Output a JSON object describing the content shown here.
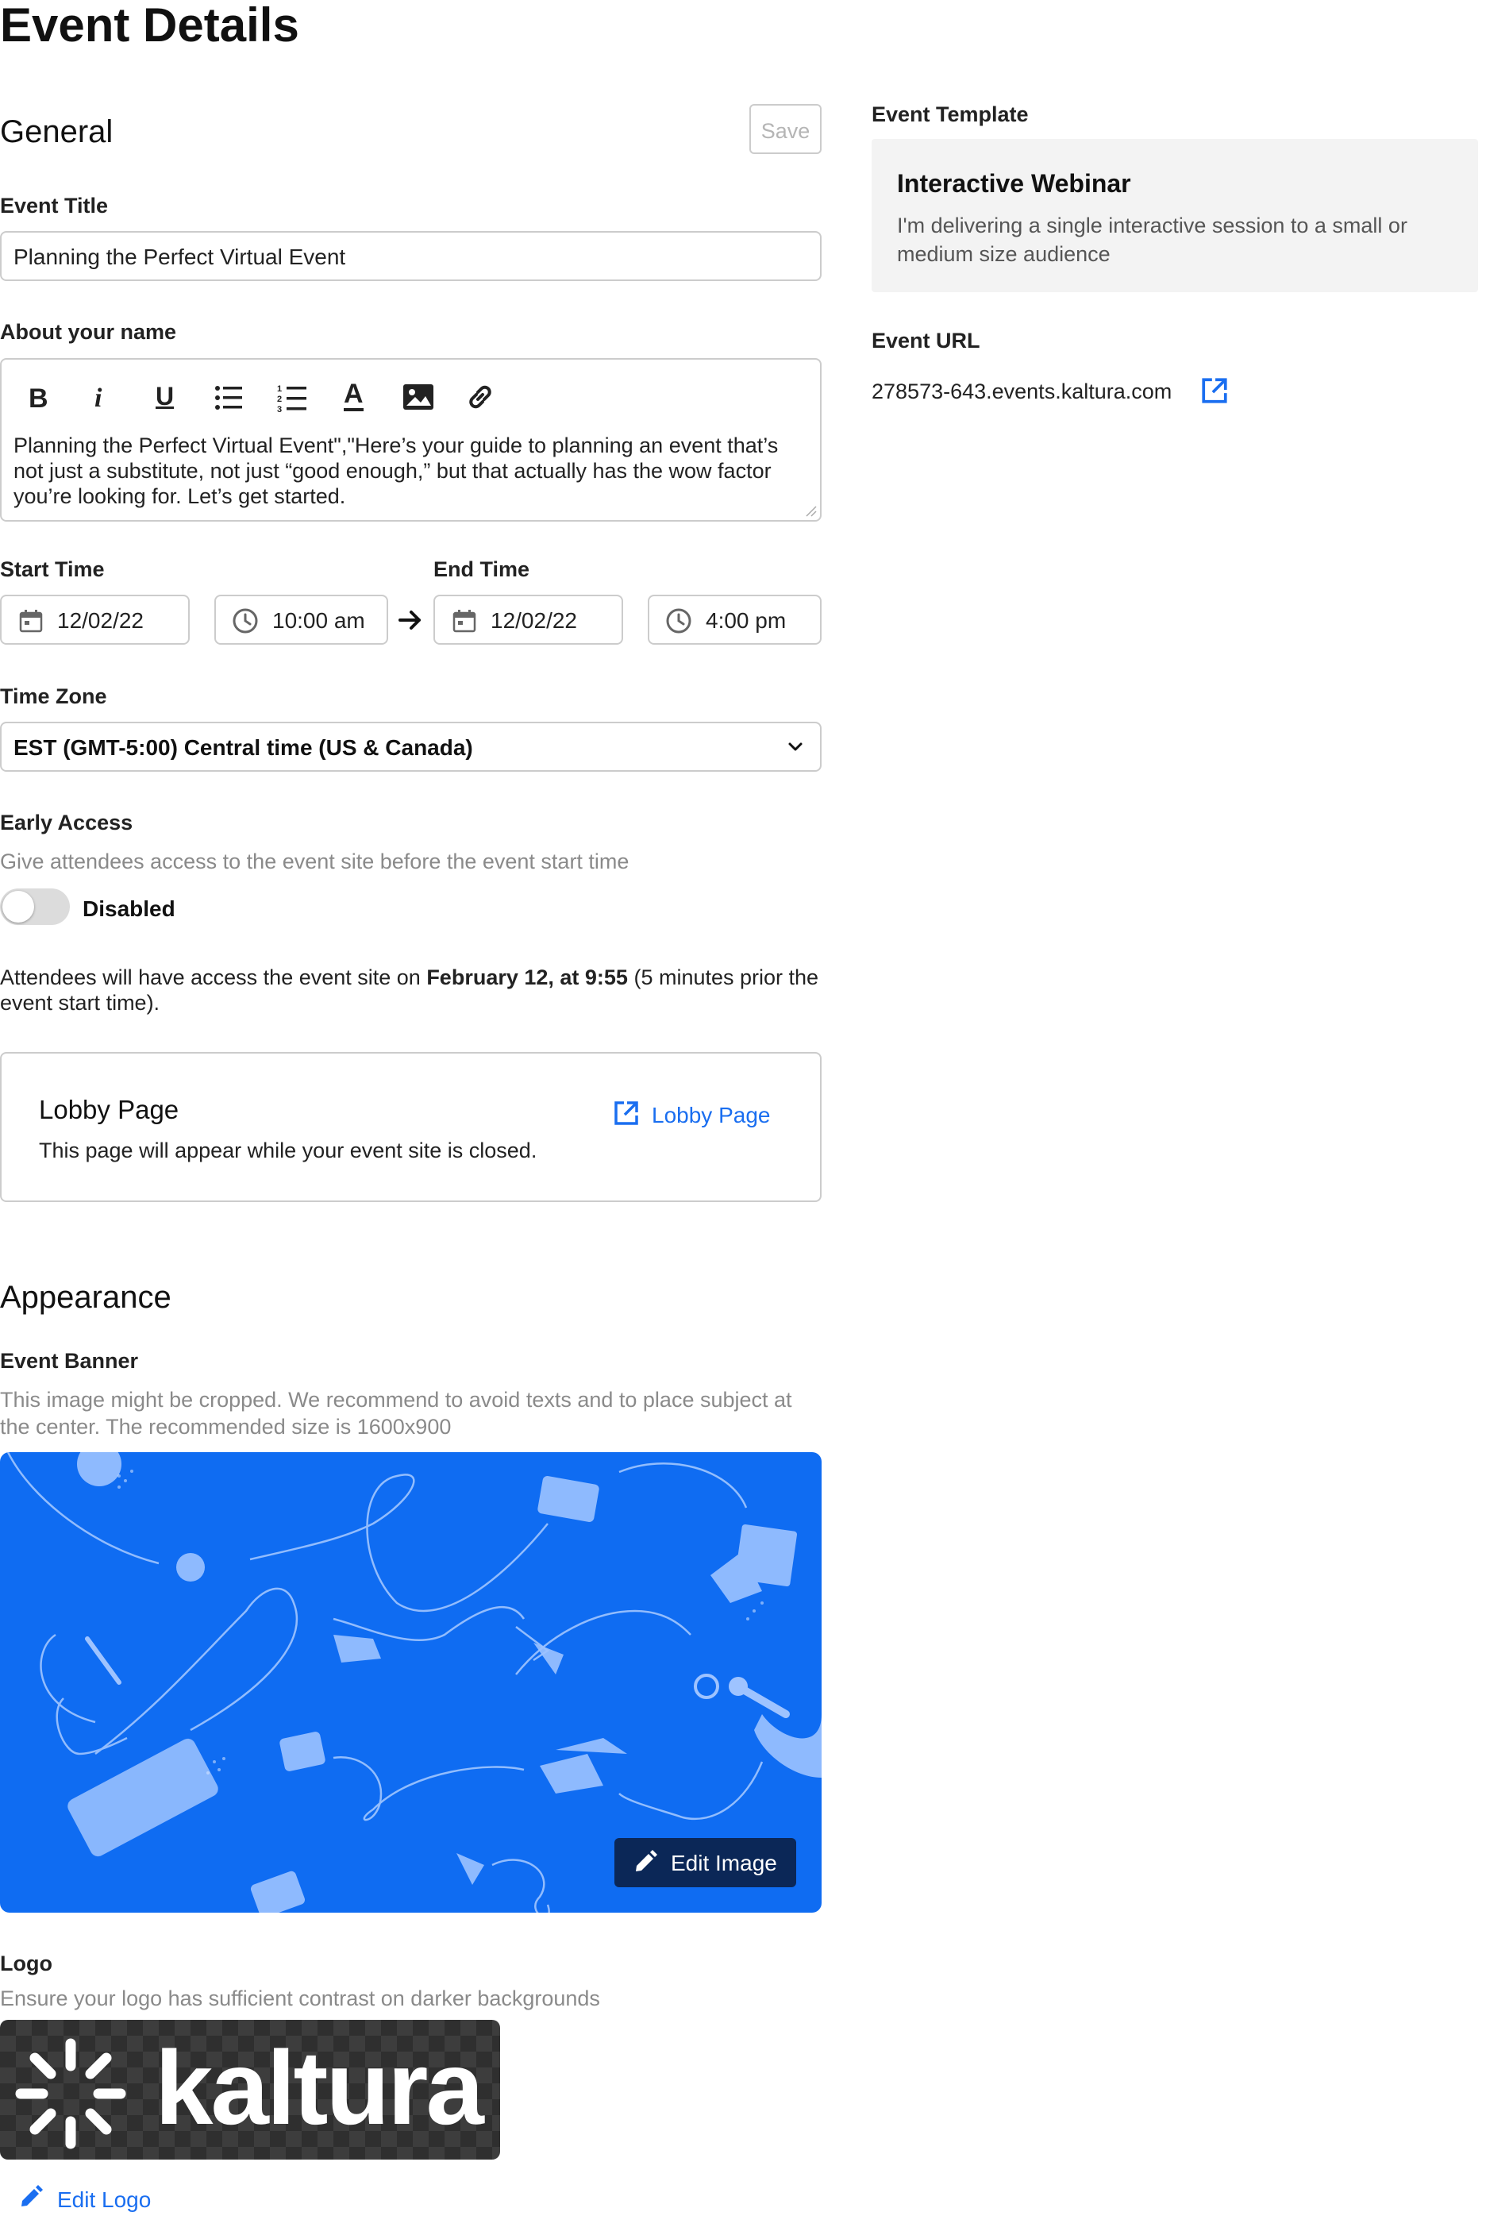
{
  "page": {
    "title": "Event Details"
  },
  "general": {
    "heading": "General",
    "save_label": "Save",
    "event_title_label": "Event Title",
    "event_title_value": "Planning the Perfect Virtual Event",
    "about_label": "About your name",
    "about_value_line1": "Planning the Perfect Virtual Event\",\"Here’s your guide to planning an event that’s",
    "about_value_line2": "not just a substitute, not just “good enough,” but that actually has the wow factor",
    "about_value_line3": "you’re looking for. Let’s get started.",
    "toolbar": [
      "bold-icon",
      "italic-icon",
      "underline-icon",
      "bulleted-list-icon",
      "numbered-list-icon",
      "text-color-icon",
      "image-icon",
      "link-icon"
    ],
    "start_time_label": "Start Time",
    "start_date": "12/02/22",
    "start_time": "10:00 am",
    "end_time_label": "End Time",
    "end_date": "12/02/22",
    "end_time": "4:00 pm",
    "time_zone_label": "Time Zone",
    "time_zone_value": "EST (GMT-5:00) Central time (US & Canada)",
    "early_access_label": "Early Access",
    "early_access_desc": "Give attendees access to the event site before the event start time",
    "toggle_label": "Disabled",
    "toggle_on": false,
    "access_note_prefix": "Attendees will have access the event site on ",
    "access_note_bold": "February 12, at 9:55",
    "access_note_suffix": " (5 minutes prior the",
    "access_note_line2": "event start time).",
    "lobby_title": "Lobby Page",
    "lobby_desc": "This page will appear while your event site is closed.",
    "lobby_link": "Lobby Page"
  },
  "sidebar": {
    "template_label": "Event Template",
    "template_title": "Interactive Webinar",
    "template_desc_line1": "I'm delivering a single interactive session to a small or",
    "template_desc_line2": "medium size audience",
    "url_label": "Event URL",
    "url_value": "278573-643.events.kaltura.com"
  },
  "appearance": {
    "heading": "Appearance",
    "banner_label": "Event Banner",
    "banner_desc_line1": "This image might be cropped. We recommend to avoid texts and to place subject at",
    "banner_desc_line2": "the center. The recommended size is 1600x900",
    "edit_image_label": "Edit Image",
    "logo_label": "Logo",
    "logo_desc": "Ensure your logo has sufficient contrast on darker backgrounds",
    "logo_text": "kaltura",
    "edit_logo_label": "Edit Logo"
  },
  "colors": {
    "accent": "#1a6ef0",
    "banner_bg": "#0f6cf2",
    "edit_button_bg": "#0b2757",
    "template_card_bg": "#f3f3f3"
  }
}
